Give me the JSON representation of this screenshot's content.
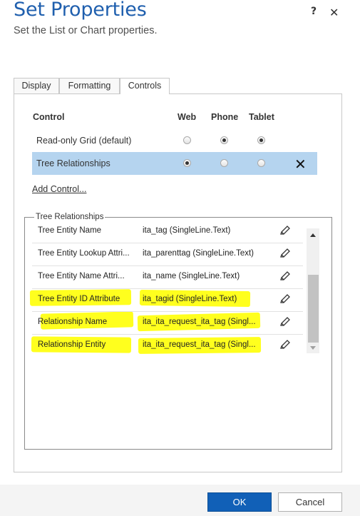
{
  "dialog": {
    "title": "Set Properties",
    "subtitle": "Set the List or Chart properties.",
    "help_label": "?",
    "close_label": "✕"
  },
  "tabs": [
    {
      "label": "Display"
    },
    {
      "label": "Formatting"
    },
    {
      "label": "Controls",
      "active": true
    }
  ],
  "controls_table": {
    "headers": {
      "control": "Control",
      "web": "Web",
      "phone": "Phone",
      "tablet": "Tablet"
    },
    "rows": [
      {
        "name": "Read-only Grid (default)",
        "web": false,
        "phone": true,
        "tablet": true,
        "selected": false
      },
      {
        "name": "Tree Relationships",
        "web": true,
        "phone": false,
        "tablet": false,
        "selected": true,
        "remove_label": "✕"
      }
    ],
    "add_control_label": "Add Control..."
  },
  "properties": {
    "legend": "Tree Relationships",
    "rows": [
      {
        "name": "Tree Entity Name",
        "value": "ita_tag (SingleLine.Text)",
        "highlighted": false
      },
      {
        "name": "Tree Entity Lookup Attri...",
        "value": "ita_parenttag (SingleLine.Text)",
        "highlighted": false
      },
      {
        "name": "Tree Entity Name Attri...",
        "value": "ita_name (SingleLine.Text)",
        "highlighted": false
      },
      {
        "name": "Tree Entity ID Attribute",
        "value": "ita_tagid (SingleLine.Text)",
        "highlighted": true
      },
      {
        "name": "Relationship Name",
        "value": "ita_ita_request_ita_tag (Singl...",
        "highlighted": true
      },
      {
        "name": "Relationship Entity",
        "value": "ita_ita_request_ita_tag (Singl...",
        "highlighted": true
      }
    ],
    "edit_icon": "pencil-icon"
  },
  "footer": {
    "ok_label": "OK",
    "cancel_label": "Cancel"
  },
  "colors": {
    "title": "#1f5fae",
    "selected_row": "#b5d4ef",
    "highlight": "#ffff1e",
    "primary_button": "#1160b7"
  }
}
